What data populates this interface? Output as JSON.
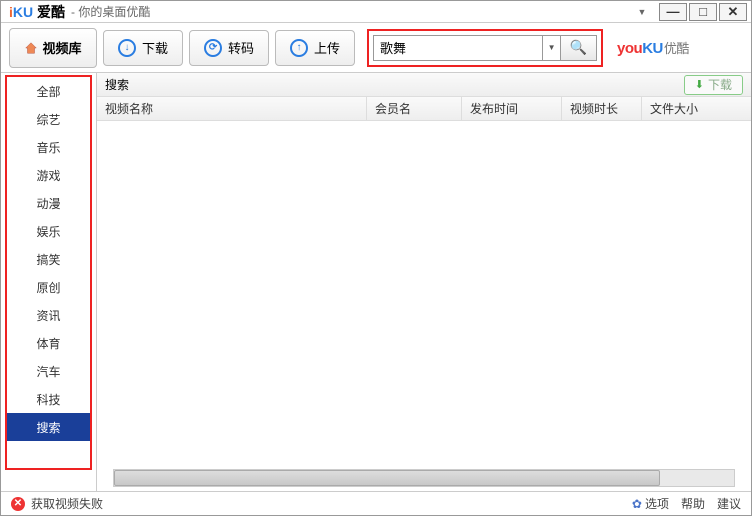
{
  "titlebar": {
    "logo_i": "i",
    "logo_ku": "KU",
    "app_name": "爱酷",
    "subtitle": "- 你的桌面优酷"
  },
  "toolbar": {
    "library_tab": "视频库",
    "download": "下载",
    "transcode": "转码",
    "upload": "上传",
    "search_value": "歌舞",
    "brand_you": "you",
    "brand_ku": "KU",
    "brand_cn": "优酷"
  },
  "sidebar": {
    "items": [
      {
        "label": "全部"
      },
      {
        "label": "综艺"
      },
      {
        "label": "音乐"
      },
      {
        "label": "游戏"
      },
      {
        "label": "动漫"
      },
      {
        "label": "娱乐"
      },
      {
        "label": "搞笑"
      },
      {
        "label": "原创"
      },
      {
        "label": "资讯"
      },
      {
        "label": "体育"
      },
      {
        "label": "汽车"
      },
      {
        "label": "科技"
      },
      {
        "label": "搜索"
      }
    ],
    "active_index": 12
  },
  "content": {
    "heading": "搜索",
    "download_btn": "下载",
    "columns": {
      "name": "视频名称",
      "member": "会员名",
      "time": "发布时间",
      "duration": "视频时长",
      "size": "文件大小"
    }
  },
  "statusbar": {
    "error": "获取视频失败",
    "options": "选项",
    "help": "帮助",
    "suggest": "建议"
  }
}
